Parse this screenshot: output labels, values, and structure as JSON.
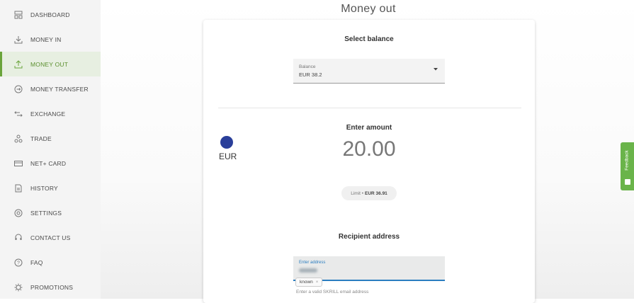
{
  "page": {
    "title": "Money out"
  },
  "sidebar": {
    "items": [
      {
        "label": "DASHBOARD",
        "icon": "dashboard-icon"
      },
      {
        "label": "MONEY IN",
        "icon": "money-in-icon"
      },
      {
        "label": "MONEY OUT",
        "icon": "money-out-icon",
        "active": true
      },
      {
        "label": "MONEY TRANSFER",
        "icon": "money-transfer-icon"
      },
      {
        "label": "EXCHANGE",
        "icon": "exchange-icon"
      },
      {
        "label": "TRADE",
        "icon": "trade-icon"
      },
      {
        "label": "NET+ CARD",
        "icon": "card-icon"
      },
      {
        "label": "HISTORY",
        "icon": "history-icon"
      },
      {
        "label": "SETTINGS",
        "icon": "settings-icon"
      },
      {
        "label": "CONTACT US",
        "icon": "contact-icon"
      },
      {
        "label": "FAQ",
        "icon": "faq-icon"
      },
      {
        "label": "PROMOTIONS",
        "icon": "promotions-icon"
      }
    ]
  },
  "balance": {
    "section_title": "Select balance",
    "caption": "Balance",
    "value": "EUR 38.2"
  },
  "amount": {
    "section_title": "Enter amount",
    "currency": "EUR",
    "value": "20.00",
    "limit_label": "Limit •",
    "limit_value": "EUR 36.91"
  },
  "recipient": {
    "section_title": "Recipient address",
    "caption": "Enter address",
    "tag": "known",
    "tag_close": "×",
    "helper": "Enter a valid SKRILL email address"
  },
  "feedback": {
    "label": "Feedback"
  },
  "colors": {
    "accent_green": "#6aa43a",
    "active_bg": "#e7efe1",
    "feedback_green": "#6ab44a",
    "focus_blue": "#2b7ec0",
    "eur_flag_blue": "#2a3f9a"
  }
}
